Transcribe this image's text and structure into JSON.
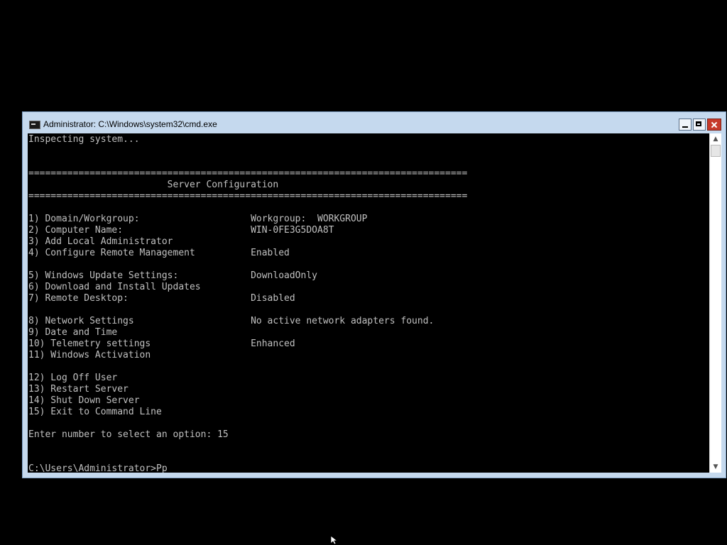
{
  "window": {
    "title": "Administrator: C:\\Windows\\system32\\cmd.exe"
  },
  "console": {
    "lines": [
      "Inspecting system...",
      "===============================================================================",
      "                         Server Configuration",
      "===============================================================================",
      "1) Domain/Workgroup:                    Workgroup:  WORKGROUP",
      "2) Computer Name:                       WIN-0FE3G5DOA8T",
      "3) Add Local Administrator",
      "4) Configure Remote Management          Enabled",
      "5) Windows Update Settings:             DownloadOnly",
      "6) Download and Install Updates",
      "7) Remote Desktop:                      Disabled",
      "8) Network Settings                     No active network adapters found.",
      "9) Date and Time",
      "10) Telemetry settings                  Enhanced",
      "11) Windows Activation",
      "12) Log Off User",
      "13) Restart Server",
      "14) Shut Down Server",
      "15) Exit to Command Line",
      "Enter number to select an option: 15",
      "C:\\Users\\Administrator>Pp"
    ]
  },
  "scrollbar": {
    "up_arrow": "▲",
    "down_arrow": "▼"
  }
}
